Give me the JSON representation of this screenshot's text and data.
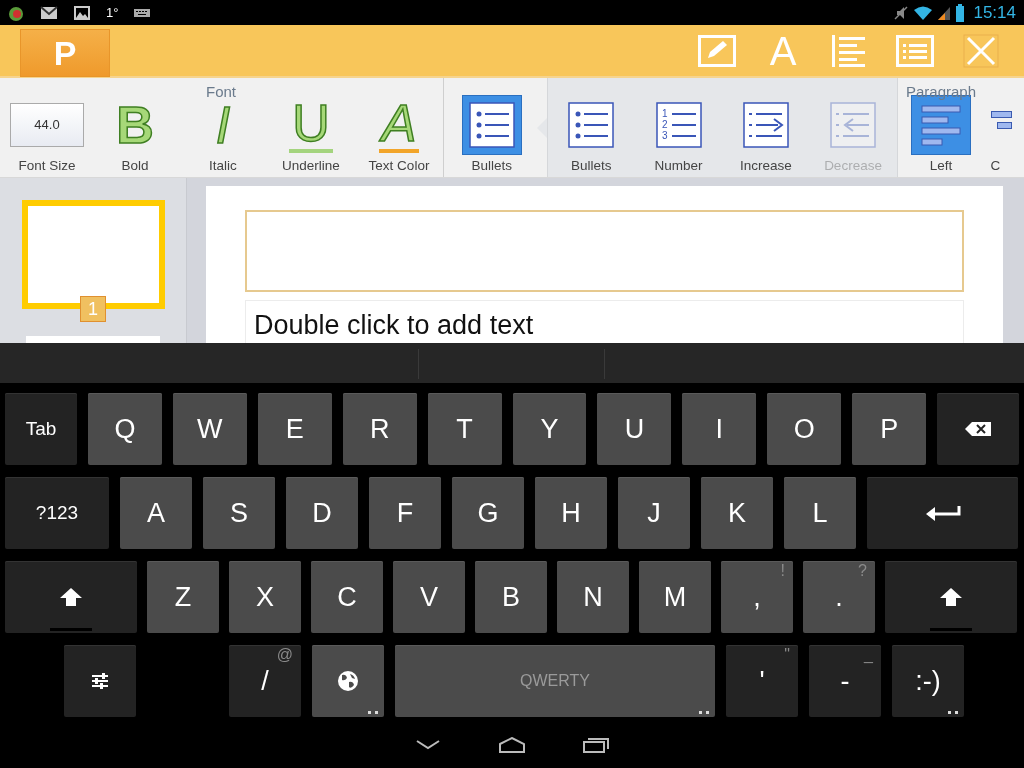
{
  "status_bar": {
    "temperature": "1°",
    "time": "15:14"
  },
  "app_bar": {
    "logo": "P",
    "actions": [
      {
        "kind": "edit"
      },
      {
        "kind": "font",
        "glyph": "A"
      },
      {
        "kind": "align"
      },
      {
        "kind": "list"
      },
      {
        "kind": "close"
      }
    ]
  },
  "font_group": {
    "label": "Font",
    "items": [
      {
        "kind": "size",
        "label": "Font Size",
        "value": "44.0"
      },
      {
        "kind": "bold",
        "label": "Bold",
        "glyph": "B"
      },
      {
        "kind": "italic",
        "label": "Italic",
        "glyph": "I"
      },
      {
        "kind": "underline",
        "label": "Underline",
        "glyph": "U"
      },
      {
        "kind": "color",
        "label": "Text Color",
        "glyph": "A"
      }
    ]
  },
  "paragraph_group": {
    "label": "Paragraph",
    "bullets_button": {
      "label": "Bullets",
      "selected": true
    },
    "popup_items": [
      {
        "kind": "bullets",
        "label": "Bullets",
        "disabled": false
      },
      {
        "kind": "number",
        "label": "Number",
        "markers": [
          "1",
          "2",
          "3"
        ],
        "disabled": false
      },
      {
        "kind": "increase",
        "label": "Increase",
        "disabled": false
      },
      {
        "kind": "decrease",
        "label": "Decrease",
        "disabled": true
      }
    ],
    "items": [
      {
        "kind": "left",
        "label": "Left",
        "selected": true
      },
      {
        "kind": "center",
        "label": "C",
        "selected": false
      }
    ]
  },
  "slides": [
    {
      "number": "1",
      "selected": true
    },
    {
      "selected": false
    }
  ],
  "slide": {
    "body_placeholder": "Double click to add text"
  },
  "keyboard": {
    "rows": [
      {
        "keys": [
          {
            "kind": "tab",
            "label": "Tab"
          },
          {
            "kind": "letter",
            "label": "Q"
          },
          {
            "kind": "letter",
            "label": "W"
          },
          {
            "kind": "letter",
            "label": "E"
          },
          {
            "kind": "letter",
            "label": "R"
          },
          {
            "kind": "letter",
            "label": "T"
          },
          {
            "kind": "letter",
            "label": "Y"
          },
          {
            "kind": "letter",
            "label": "U"
          },
          {
            "kind": "letter",
            "label": "I"
          },
          {
            "kind": "letter",
            "label": "O"
          },
          {
            "kind": "letter",
            "label": "P"
          },
          {
            "kind": "backspace"
          }
        ]
      },
      {
        "keys": [
          {
            "kind": "symbols",
            "label": "?123"
          },
          {
            "kind": "letter",
            "label": "A"
          },
          {
            "kind": "letter",
            "label": "S"
          },
          {
            "kind": "letter",
            "label": "D"
          },
          {
            "kind": "letter",
            "label": "F"
          },
          {
            "kind": "letter",
            "label": "G"
          },
          {
            "kind": "letter",
            "label": "H"
          },
          {
            "kind": "letter",
            "label": "J"
          },
          {
            "kind": "letter",
            "label": "K"
          },
          {
            "kind": "letter",
            "label": "L"
          },
          {
            "kind": "enter"
          }
        ]
      },
      {
        "keys": [
          {
            "kind": "shift"
          },
          {
            "kind": "letter",
            "label": "Z"
          },
          {
            "kind": "letter",
            "label": "X"
          },
          {
            "kind": "letter",
            "label": "C"
          },
          {
            "kind": "letter",
            "label": "V"
          },
          {
            "kind": "letter",
            "label": "B"
          },
          {
            "kind": "letter",
            "label": "N"
          },
          {
            "kind": "letter",
            "label": "M"
          },
          {
            "kind": "letter",
            "label": ",",
            "hint": "!"
          },
          {
            "kind": "letter",
            "label": ".",
            "hint": "?"
          },
          {
            "kind": "shift"
          }
        ]
      },
      {
        "keys": [
          {
            "kind": "settings"
          },
          {
            "kind": "punct",
            "label": "/",
            "hint": "@"
          },
          {
            "kind": "globe",
            "more": true
          },
          {
            "kind": "space",
            "label": "QWERTY",
            "more": true
          },
          {
            "kind": "punct",
            "label": "'",
            "hint": "\""
          },
          {
            "kind": "punct",
            "label": "-",
            "hint": "_"
          },
          {
            "kind": "punct",
            "label": ":-)",
            "more": true
          }
        ]
      }
    ]
  }
}
